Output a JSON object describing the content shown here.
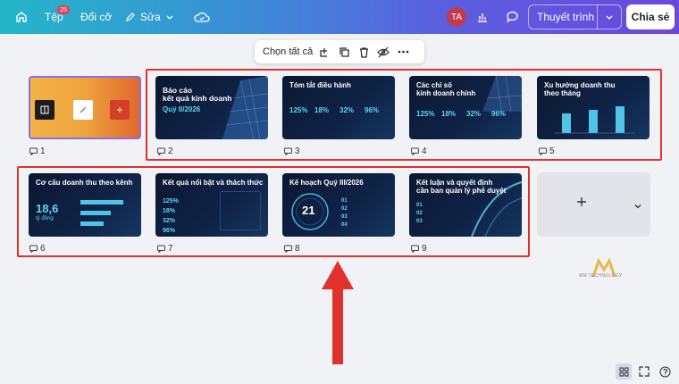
{
  "topbar": {
    "file_label": "Tệp",
    "file_badge": "25",
    "resize_label": "Đổi cỡ",
    "edit_label": "Sửa",
    "avatar_initials": "TA",
    "present_label": "Thuyết trình",
    "share_label": "Chia sẻ"
  },
  "toolbar": {
    "select_all_label": "Chọn tất cả"
  },
  "slides": [
    {
      "number": "1"
    },
    {
      "number": "2",
      "title": "Báo cáo\nkết quả kinh doanh",
      "subtitle": "Quý II/2026"
    },
    {
      "number": "3",
      "title": "Tóm tắt điều hành",
      "stats": [
        "125%",
        "18%",
        "32%",
        "96%"
      ]
    },
    {
      "number": "4",
      "title": "Các chỉ số\nkinh doanh chính",
      "stats": [
        "125%",
        "18%",
        "32%",
        "96%"
      ]
    },
    {
      "number": "5",
      "title": "Xu hướng doanh thu\ntheo tháng"
    },
    {
      "number": "6",
      "title": "Cơ cấu doanh thu theo kênh",
      "big_value": "18,6",
      "big_unit": "tỷ đồng"
    },
    {
      "number": "7",
      "title": "Kết quả nổi bật và thách thức",
      "stats": [
        "125%",
        "18%",
        "32%",
        "96%"
      ]
    },
    {
      "number": "8",
      "title": "Kế hoạch Quý III/2026",
      "big_value": "21",
      "items": [
        "01",
        "02",
        "03",
        "04"
      ]
    },
    {
      "number": "9",
      "title": "Kết luận và quyết định\ncần ban quản lý phê duyệt",
      "items": [
        "01",
        "02",
        "03"
      ]
    }
  ],
  "logo_text": "MM TECHNOLOGY",
  "colors": {
    "accent_red": "#e0322c",
    "stat_cyan": "#5fd5f5",
    "slide_bg": "#0f2347"
  }
}
